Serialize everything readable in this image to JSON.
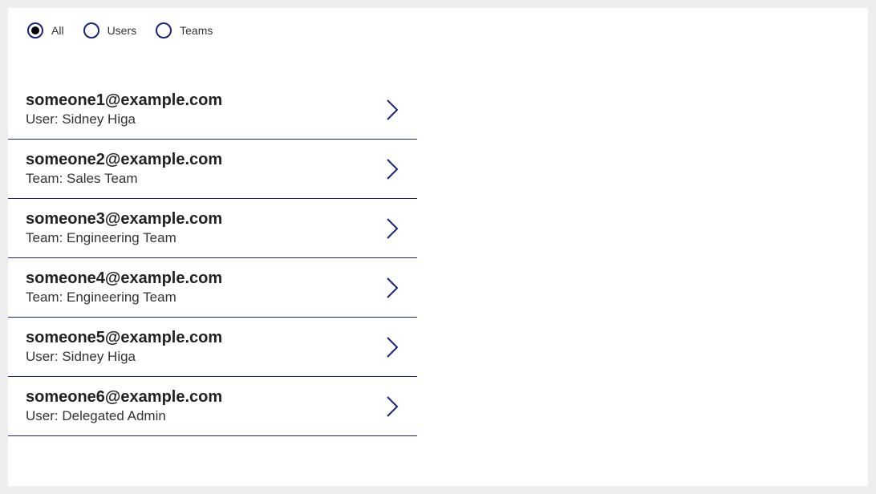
{
  "filter": {
    "options": [
      {
        "label": "All",
        "selected": true
      },
      {
        "label": "Users",
        "selected": false
      },
      {
        "label": "Teams",
        "selected": false
      }
    ]
  },
  "list": {
    "items": [
      {
        "primary": "someone1@example.com",
        "secondary": "User: Sidney Higa"
      },
      {
        "primary": "someone2@example.com",
        "secondary": "Team: Sales Team"
      },
      {
        "primary": "someone3@example.com",
        "secondary": "Team: Engineering Team"
      },
      {
        "primary": "someone4@example.com",
        "secondary": "Team: Engineering Team"
      },
      {
        "primary": "someone5@example.com",
        "secondary": "User: Sidney Higa"
      },
      {
        "primary": "someone6@example.com",
        "secondary": "User: Delegated Admin"
      }
    ]
  },
  "colors": {
    "accent": "#1a237e"
  }
}
